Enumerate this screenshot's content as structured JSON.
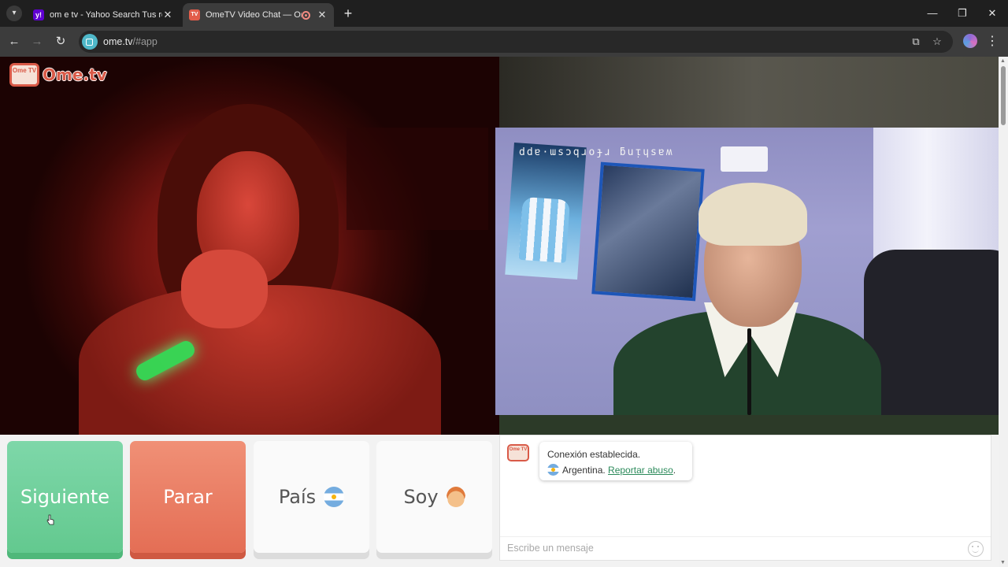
{
  "browser": {
    "tabs": [
      {
        "title": "om e tv - Yahoo Search Tus res",
        "favicon": "yahoo-favicon",
        "active": false
      },
      {
        "title": "OmeTV Video Chat — Ome",
        "favicon": "ometv-favicon",
        "active": true,
        "recording": true
      }
    ],
    "new_tab_label": "+",
    "url_host": "ome.tv",
    "url_path": "/#app",
    "window_controls": {
      "minimize": "—",
      "maximize": "❐",
      "close": "✕"
    }
  },
  "logo": {
    "tv_text": "Ome TV",
    "wordmark": "Ome.tv"
  },
  "own_video": {
    "mirrored_text": "ddɐ·ɯsɔqɹoɟɹ ƃuᴉɥsɐʍ"
  },
  "controls": {
    "next_label": "Siguiente",
    "stop_label": "Parar",
    "country_label": "País",
    "country_flag": "argentina-flag",
    "gender_label": "Soy",
    "gender_icon": "boy-emoji-icon"
  },
  "chat": {
    "avatar_text": "Ome TV",
    "messages": [
      {
        "line1": "Conexión establecida.",
        "country": "Argentina.",
        "report_link": "Reportar abuso",
        "after_link": "."
      }
    ],
    "input_placeholder": "Escribe un mensaje"
  },
  "colors": {
    "next": "#63c98f",
    "stop": "#e46e55",
    "brand": "#d95a48",
    "link": "#2b8a5a"
  }
}
